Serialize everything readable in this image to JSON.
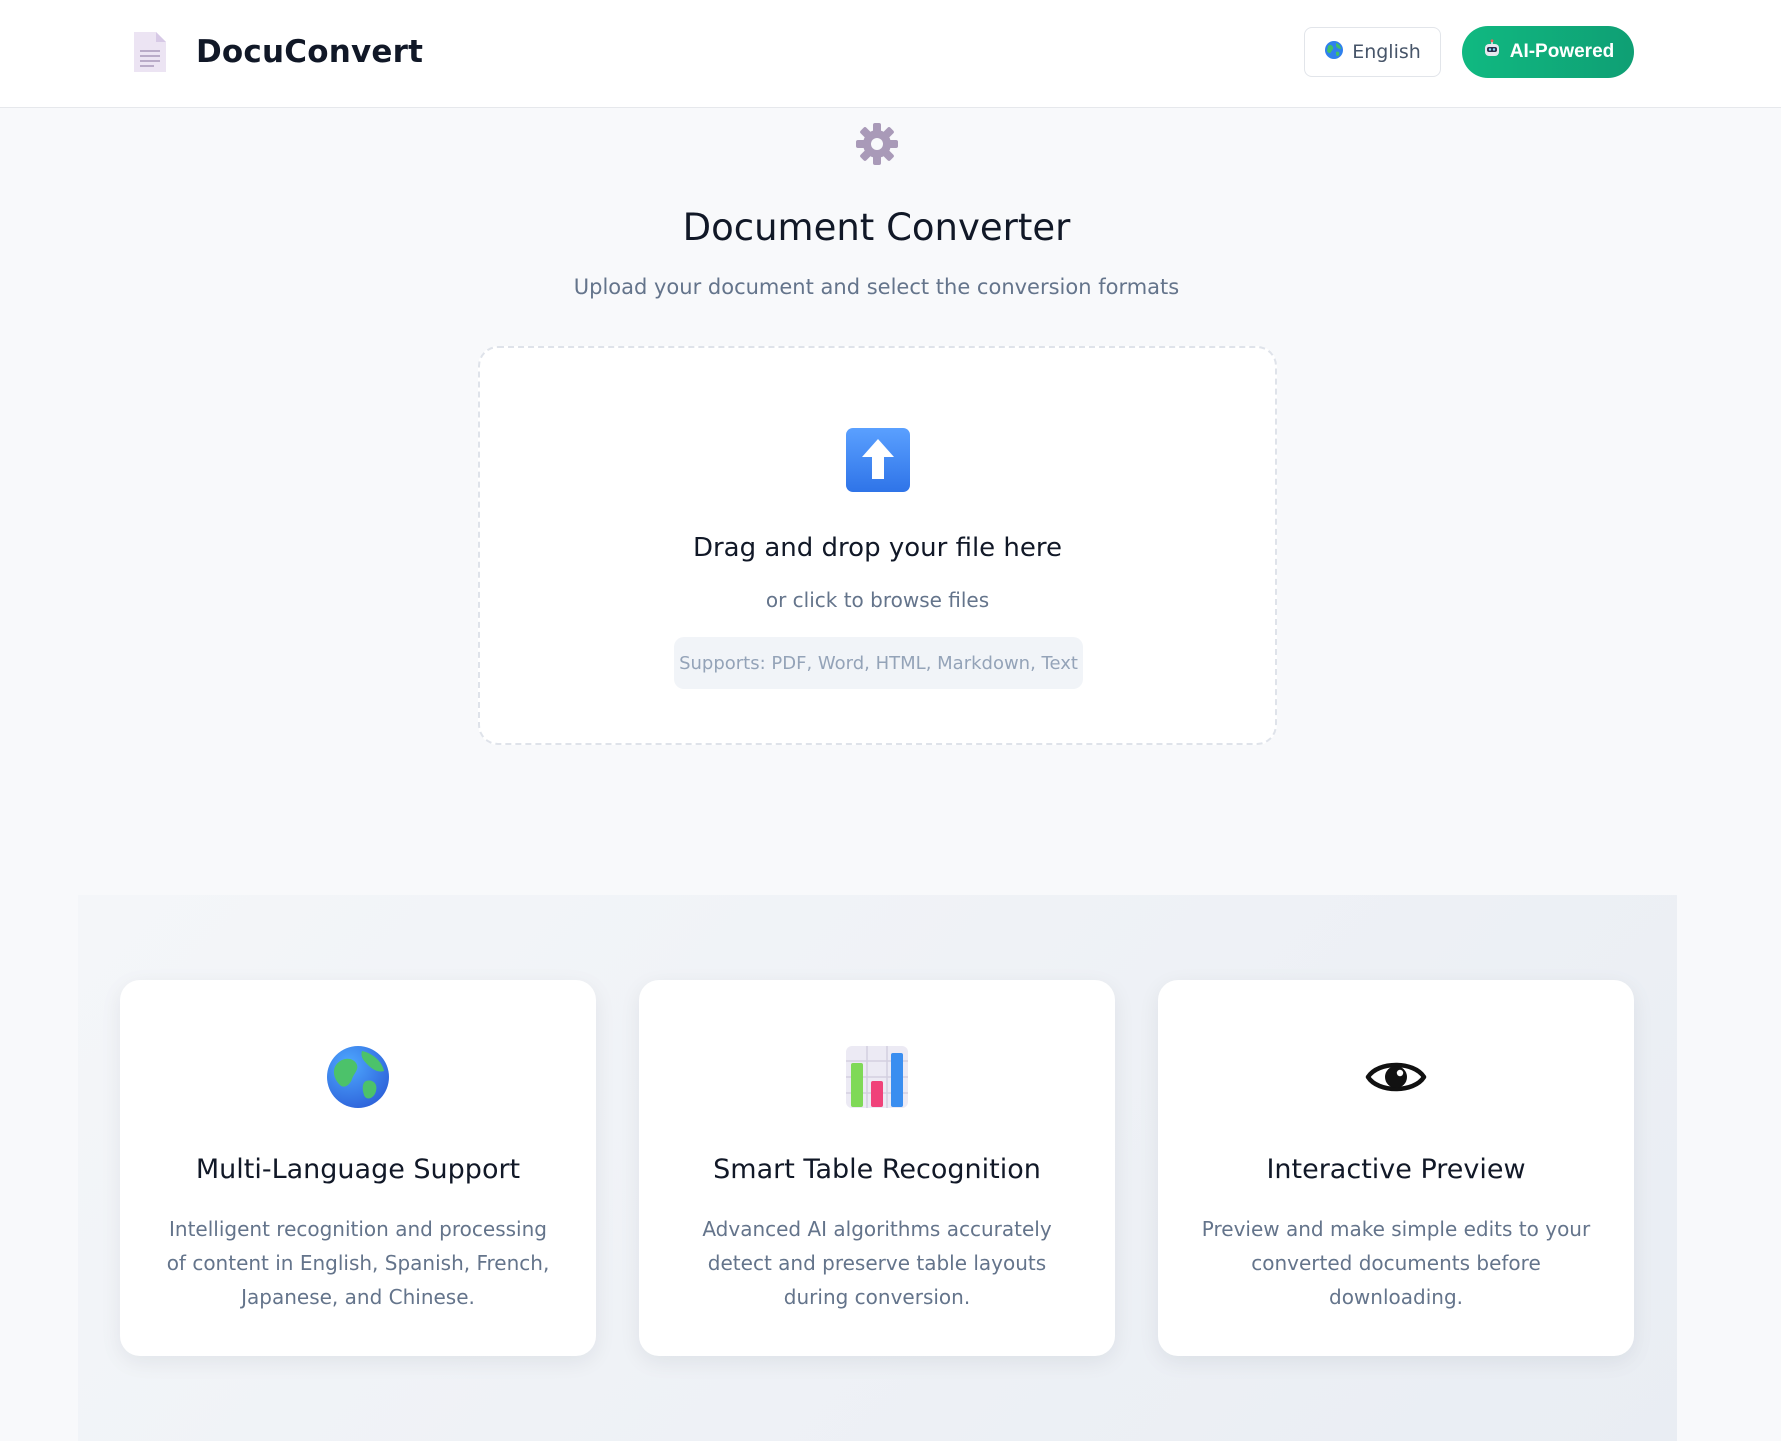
{
  "header": {
    "brand_name": "DocuConvert",
    "brand_icon": "document-icon",
    "language": {
      "icon": "globe-icon",
      "label": "English"
    },
    "ai_badge": {
      "icon": "robot-icon",
      "label": "AI-Powered"
    }
  },
  "hero": {
    "icon": "gear-icon",
    "title": "Document Converter",
    "subtitle": "Upload your document and select the conversion formats"
  },
  "upload": {
    "icon": "up-arrow-icon",
    "title": "Drag and drop your file here",
    "subtitle": "or click to browse files",
    "supports": "Supports: PDF, Word, HTML, Markdown, Text"
  },
  "features": [
    {
      "icon": "globe-icon",
      "title": "Multi-Language Support",
      "description": "Intelligent recognition and processing of content in English, Spanish, French, Japanese, and Chinese."
    },
    {
      "icon": "bar-chart-icon",
      "title": "Smart Table Recognition",
      "description": "Advanced AI algorithms accurately detect and preserve table layouts during conversion."
    },
    {
      "icon": "eye-icon",
      "title": "Interactive Preview",
      "description": "Preview and make simple edits to your converted documents before downloading."
    }
  ],
  "colors": {
    "accent_green": "#10b981",
    "background": "#f8f9fb",
    "text_primary": "#111827",
    "text_muted": "#64748b"
  }
}
